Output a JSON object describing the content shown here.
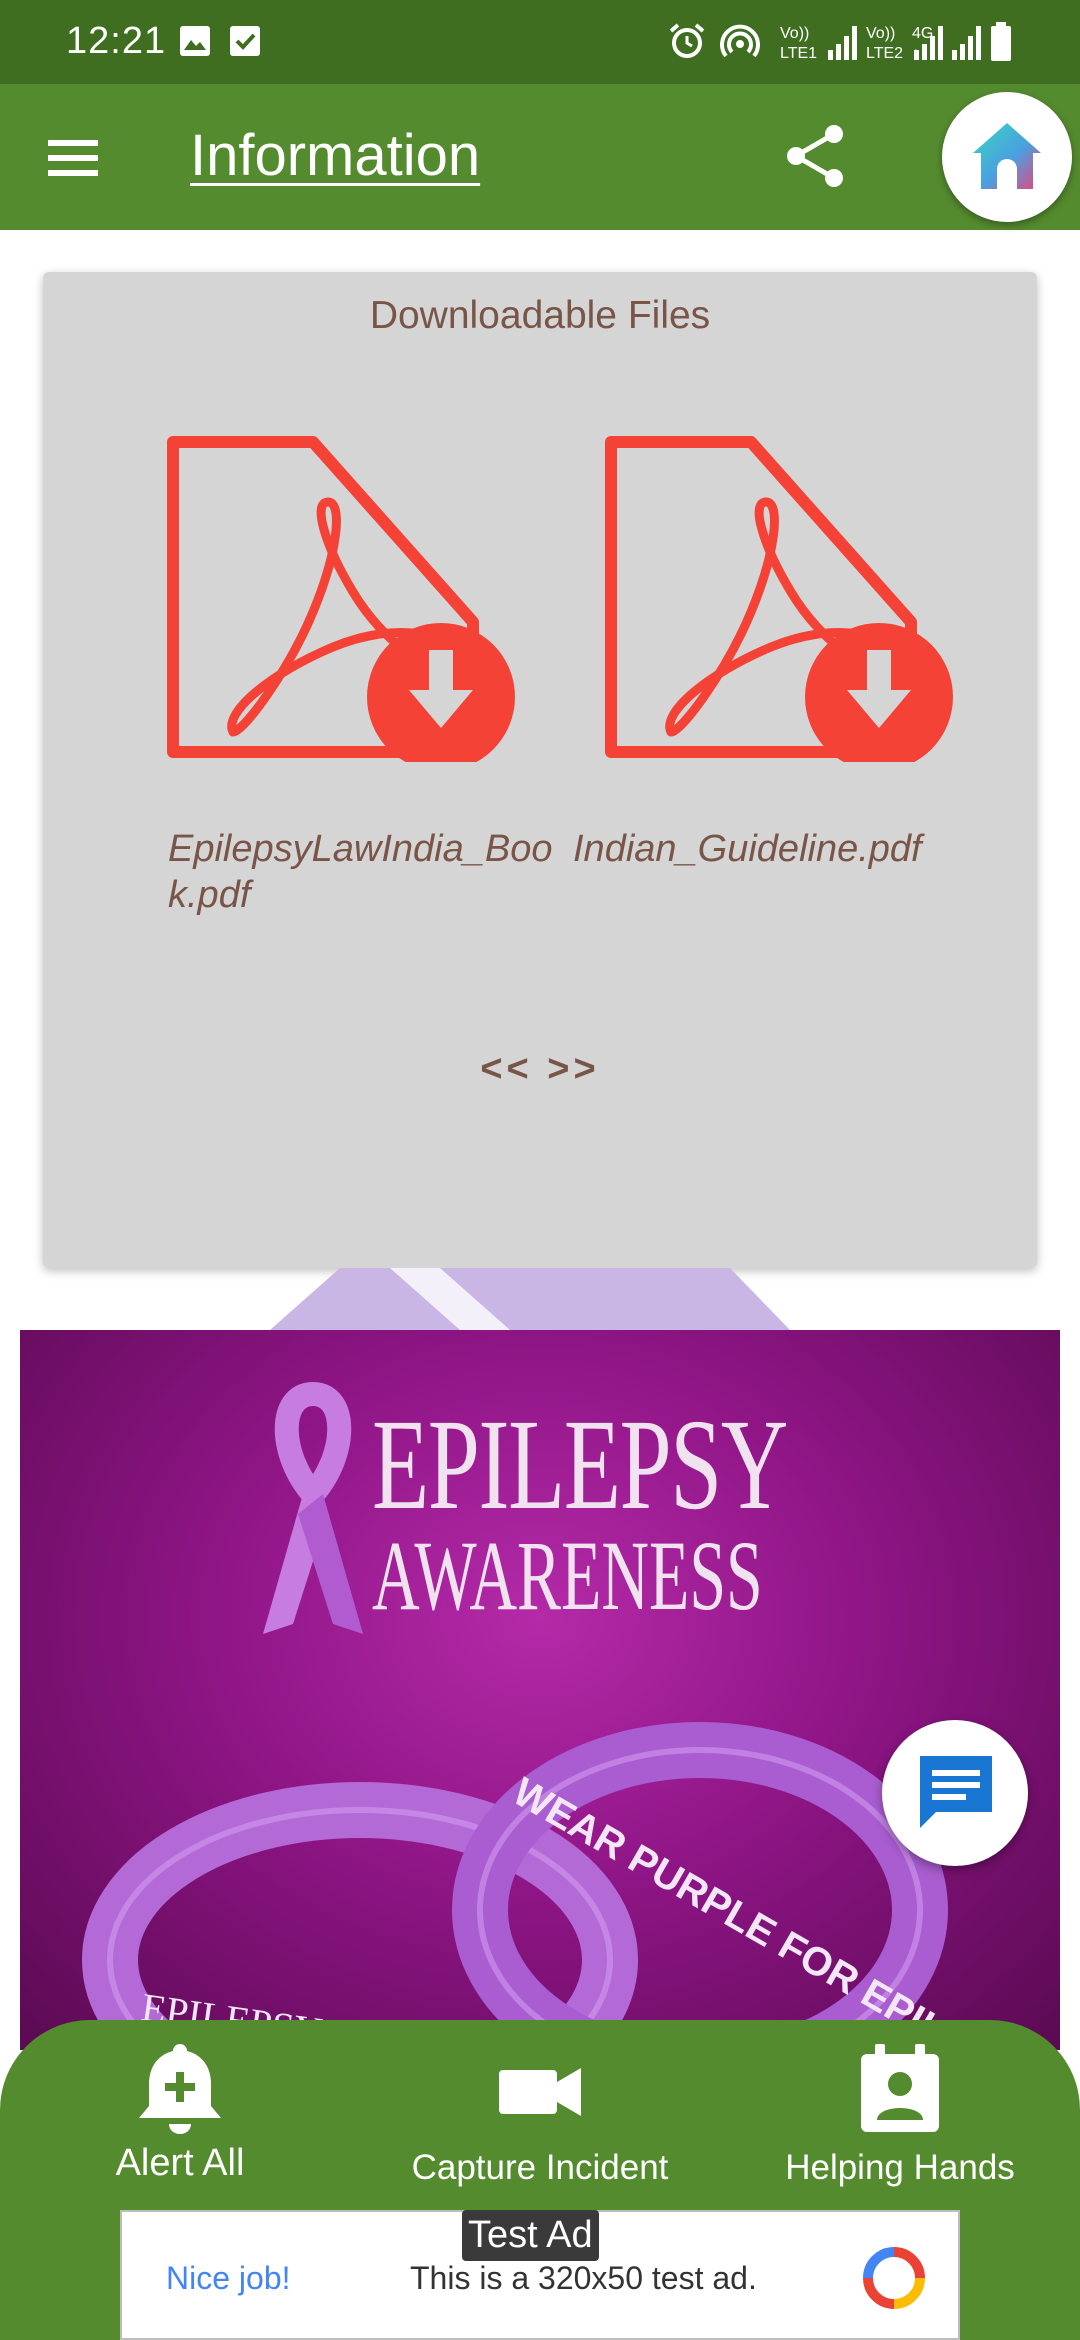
{
  "status_bar": {
    "time": "12:21",
    "icons": [
      "image-icon",
      "check-box-icon",
      "alarm-icon",
      "hotspot-icon",
      "volte-sim1-signal-icon",
      "volte-sim2-signal-icon",
      "4g-signal-icon",
      "battery-icon"
    ],
    "sim1_label": "Vo)) LTE1",
    "sim2_label": "Vo)) LTE2",
    "network": "4G"
  },
  "app_bar": {
    "title": "Information",
    "menu_icon": "menu-icon",
    "share_icon": "share-icon",
    "home_icon": "home-icon"
  },
  "files_card": {
    "title": "Downloadable Files",
    "files": [
      {
        "name": "EpilepsyLawIndia_Book.pdf",
        "icon": "pdf-download-icon"
      },
      {
        "name": "Indian_Guideline.pdf",
        "icon": "pdf-download-icon"
      }
    ],
    "pager_label": "<< >>"
  },
  "banner": {
    "line1": "EPILEPSY",
    "line2": "AWARENESS",
    "band_text_left": "EPILEPSY Awareness",
    "band_text_right": "WEAR PURPLE FOR EPILEPSY"
  },
  "chat_fab_icon": "chat-icon",
  "bottom_nav": {
    "items": [
      {
        "label": "Alert All",
        "icon": "bell-plus-icon"
      },
      {
        "label": "Capture Incident",
        "icon": "video-camera-icon"
      },
      {
        "label": "Helping Hands",
        "icon": "contact-badge-icon"
      }
    ]
  },
  "ad": {
    "tag": "Test Ad",
    "nice": "Nice job!",
    "text": "This is a 320x50 test ad."
  },
  "colors": {
    "status_bar": "#3f6e21",
    "app_bar": "#558b2f",
    "card_bg": "#d5d5d5",
    "card_text": "#795548",
    "pdf_red": "#f44336",
    "banner_purple": "#8e1585"
  }
}
